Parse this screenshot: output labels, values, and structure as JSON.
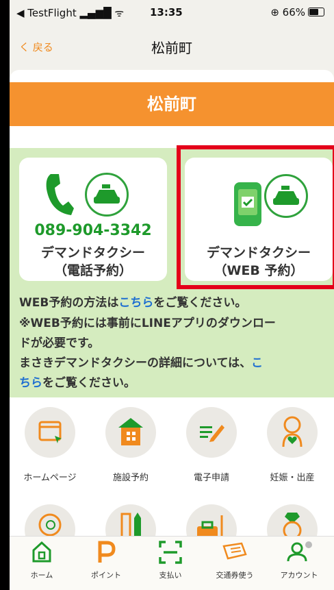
{
  "status_bar": {
    "carrier": "◀ TestFlight",
    "signal": "▂▄▆█ ᯤ",
    "time": "13:35",
    "battery": "⊕ 66%"
  },
  "nav": {
    "back_label": "く 戻る",
    "title": "松前町"
  },
  "banner": {
    "title": "松前町"
  },
  "tiles": [
    {
      "phone_number": "089-904-3342",
      "line1": "デマンドタクシー",
      "line2": "（電話予約）"
    },
    {
      "line1": "デマンドタクシー",
      "line2": "（WEB 予約）"
    }
  ],
  "info": {
    "web_prefix": "WEB予約の方法は",
    "web_link": "こちら",
    "web_suffix": "をご覧ください。",
    "notice1": "※WEB予約には事前にLINEアプリのダウンロー",
    "notice2": "ドが必要です。",
    "detail_prefix": "まさきデマンドタクシーの詳細については、",
    "detail_link_a": "こ",
    "detail_link_b": "ちら",
    "detail_suffix": "をご覧ください。"
  },
  "grid": [
    {
      "label": "ホームページ",
      "icon": "homepage-icon"
    },
    {
      "label": "施設予約",
      "icon": "facility-icon"
    },
    {
      "label": "電子申請",
      "icon": "application-icon"
    },
    {
      "label": "妊娠・出産",
      "icon": "pregnancy-icon"
    },
    {
      "label": "",
      "icon": "baby-icon"
    },
    {
      "label": "",
      "icon": "ruler-pencil-icon"
    },
    {
      "label": "",
      "icon": "briefcase-icon"
    },
    {
      "label": "",
      "icon": "ring-icon"
    }
  ],
  "tabbar": [
    {
      "label": "ホーム",
      "icon": "home-icon"
    },
    {
      "label": "ポイント",
      "icon": "point-icon"
    },
    {
      "label": "支払い",
      "icon": "scan-icon"
    },
    {
      "label": "交通券使う",
      "icon": "ticket-icon"
    },
    {
      "label": "アカウント",
      "icon": "account-icon"
    }
  ]
}
